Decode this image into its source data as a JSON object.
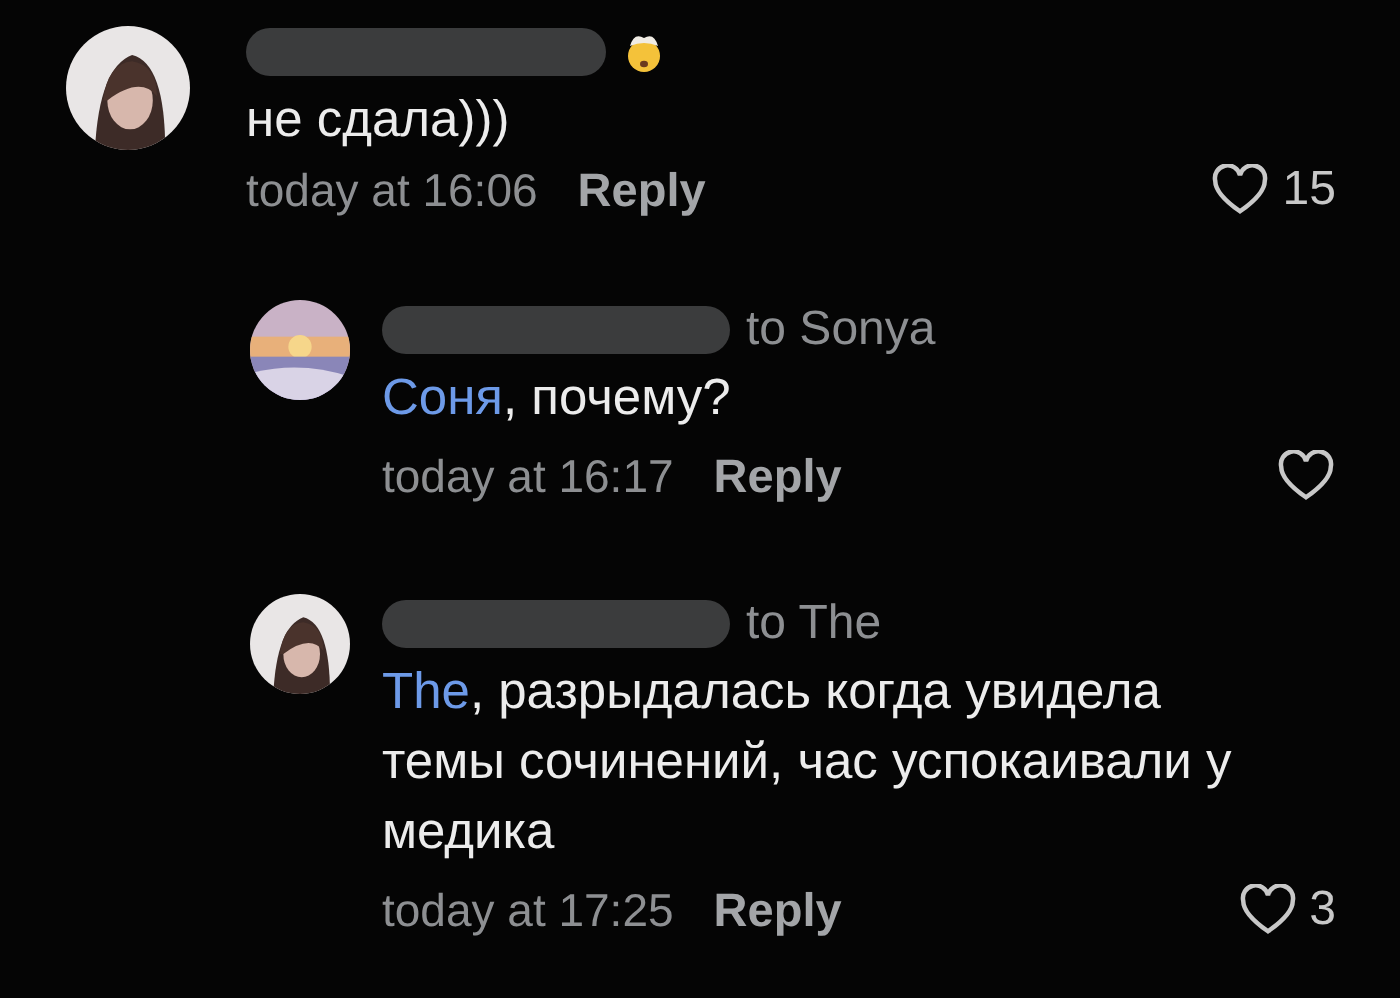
{
  "comments": [
    {
      "kind": "comment",
      "author_emoji": true,
      "text": "не сдала)))",
      "time": "today at 16:06",
      "reply": "Reply",
      "liked": false,
      "likes": "15"
    },
    {
      "kind": "reply",
      "author_emoji": false,
      "to": "to Sonya",
      "mention": "Соня",
      "text": ", почему?",
      "time": "today at 16:17",
      "reply": "Reply",
      "liked": false
    },
    {
      "kind": "reply",
      "author_emoji": false,
      "to": "to The",
      "mention": "The",
      "text": ", разрыдалась когда увидела темы сочинений, час успокаивали у медика",
      "time": "today at 17:25",
      "reply": "Reply",
      "liked": false,
      "likes": "3"
    }
  ]
}
